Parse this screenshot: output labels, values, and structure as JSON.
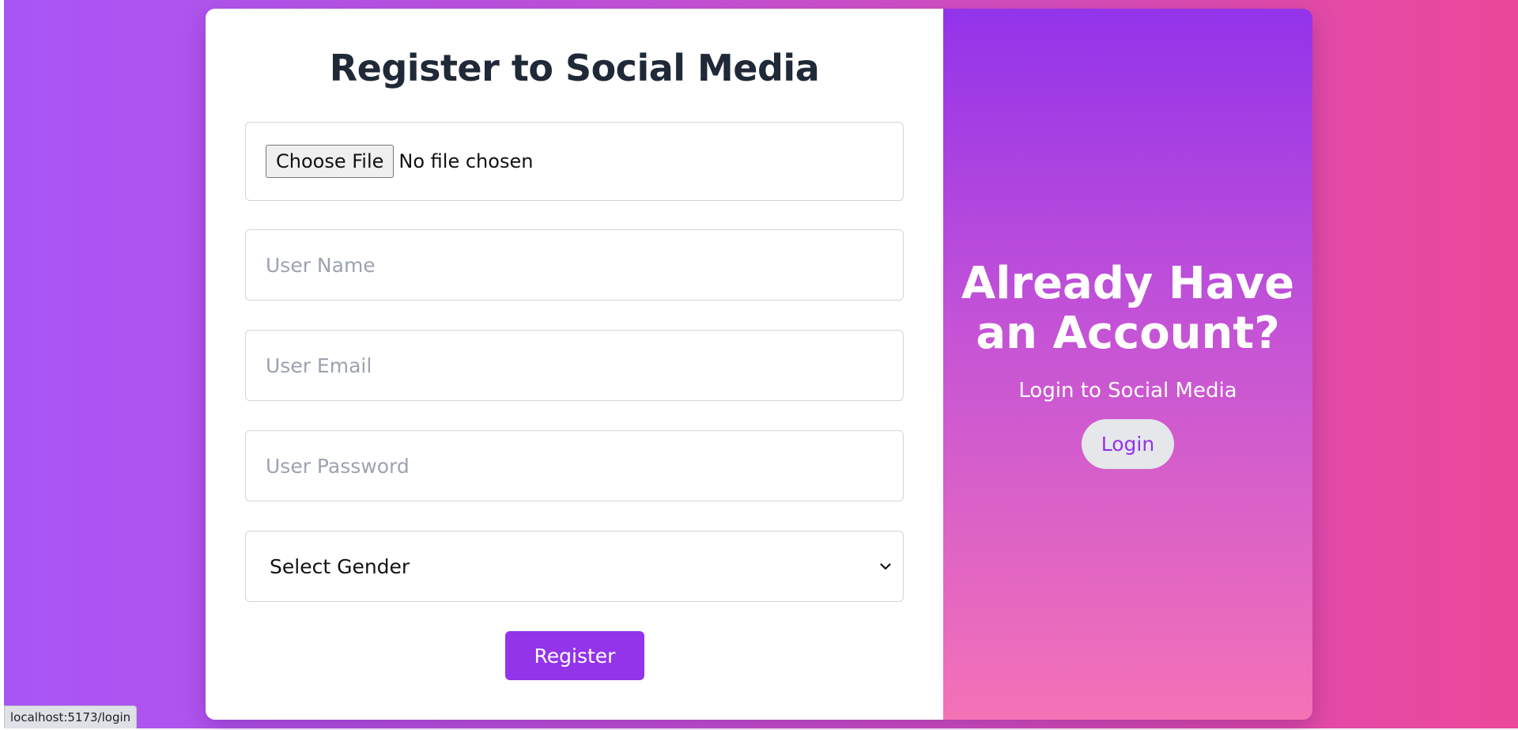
{
  "register": {
    "title": "Register to Social Media",
    "file_input": {
      "button_label": "Choose File",
      "status": "No file chosen"
    },
    "username_placeholder": "User Name",
    "email_placeholder": "User Email",
    "password_placeholder": "User Password",
    "gender_select": {
      "selected": "Select Gender"
    },
    "submit_label": "Register"
  },
  "login_panel": {
    "title": "Already Have an Account?",
    "subtitle": "Login to Social Media",
    "button_label": "Login"
  },
  "status_bar": {
    "url": "localhost:5173/login"
  },
  "colors": {
    "accent": "#9333ea",
    "background_start": "#a855f7",
    "background_end": "#ec4899",
    "title_text": "#1f2937"
  }
}
